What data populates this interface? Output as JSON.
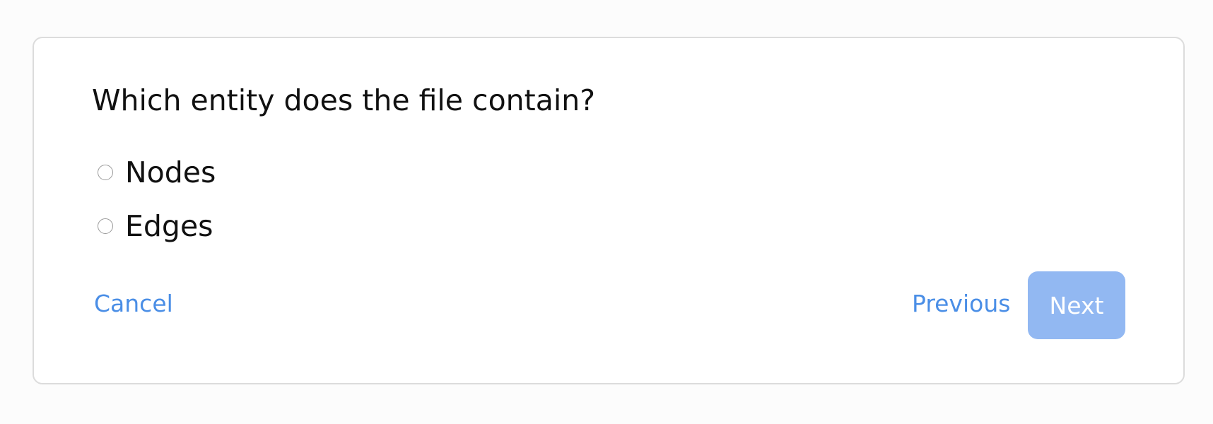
{
  "dialog": {
    "question": "Which entity does the file contain?",
    "options": [
      {
        "label": "Nodes",
        "selected": false
      },
      {
        "label": "Edges",
        "selected": false
      }
    ],
    "cancel_label": "Cancel",
    "previous_label": "Previous",
    "next_label": "Next",
    "next_enabled": false
  },
  "colors": {
    "accent": "#4a8ee6",
    "next_disabled_bg": "#92b8f2",
    "background": "#fcfcfc",
    "card_border": "#dcdcdc"
  },
  "icons": {
    "radio": "radio-unchecked-icon"
  }
}
